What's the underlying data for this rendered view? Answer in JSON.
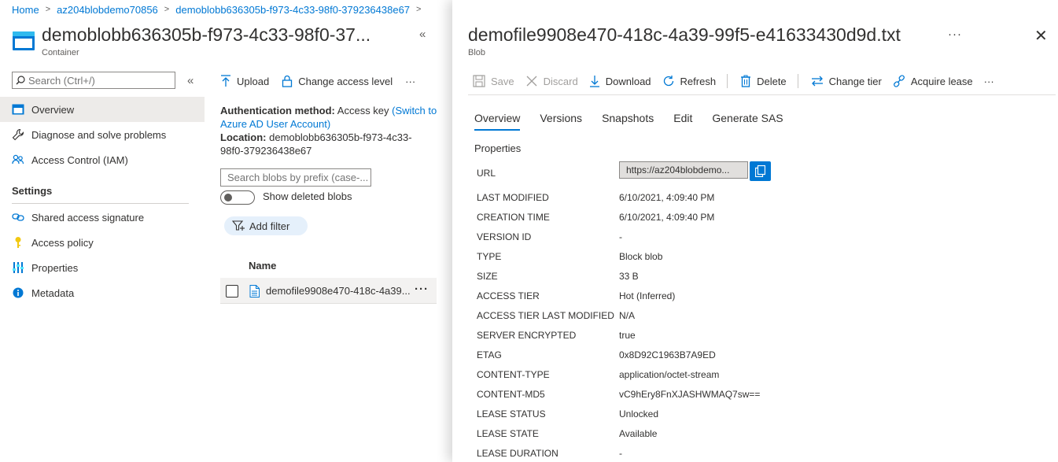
{
  "breadcrumb": {
    "items": [
      "Home",
      "az204blobdemo70856",
      "demoblobb636305b-f973-4c33-98f0-379236438e67"
    ],
    "separator": ">"
  },
  "container": {
    "title": "demoblobb636305b-f973-4c33-98f0-37...",
    "subtitle": "Container"
  },
  "search": {
    "placeholder": "Search (Ctrl+/)"
  },
  "nav": {
    "items": [
      {
        "label": "Overview",
        "icon": "container-icon",
        "selected": true
      },
      {
        "label": "Diagnose and solve problems",
        "icon": "wrench-icon"
      },
      {
        "label": "Access Control (IAM)",
        "icon": "people-icon"
      }
    ],
    "settings_heading": "Settings",
    "settings_items": [
      {
        "label": "Shared access signature",
        "icon": "link-icon"
      },
      {
        "label": "Access policy",
        "icon": "key-icon"
      },
      {
        "label": "Properties",
        "icon": "properties-icon"
      },
      {
        "label": "Metadata",
        "icon": "info-icon"
      }
    ]
  },
  "middle": {
    "toolbar": {
      "upload": "Upload",
      "change_access": "Change access level",
      "more": "···"
    },
    "auth": {
      "label": "Authentication method:",
      "value": "Access key",
      "link_line1": "(Switch to",
      "link_line2": "Azure AD User Account)"
    },
    "location": {
      "label": "Location:",
      "value_line1": "demoblobb636305b-f973-4c33-",
      "value_line2": "98f0-379236438e67"
    },
    "blob_search": {
      "placeholder": "Search blobs by prefix (case-..."
    },
    "show_deleted": {
      "label": "Show deleted blobs",
      "on": false
    },
    "add_filter": "Add filter",
    "column_name": "Name",
    "rows": [
      {
        "name": "demofile9908e470-418c-4a39...",
        "more": "···"
      }
    ]
  },
  "panel": {
    "title": "demofile9908e470-418c-4a39-99f5-e41633430d9d.txt",
    "subtitle": "Blob",
    "more": "···",
    "close": "✕",
    "toolbar": {
      "save": "Save",
      "discard": "Discard",
      "download": "Download",
      "refresh": "Refresh",
      "delete": "Delete",
      "change_tier": "Change tier",
      "acquire_lease": "Acquire lease",
      "more": "···"
    },
    "tabs": [
      "Overview",
      "Versions",
      "Snapshots",
      "Edit",
      "Generate SAS"
    ],
    "properties_heading": "Properties",
    "url": {
      "label": "URL",
      "value": "https://az204blobdemo..."
    },
    "properties": [
      {
        "key": "LAST MODIFIED",
        "value": "6/10/2021, 4:09:40 PM"
      },
      {
        "key": "CREATION TIME",
        "value": "6/10/2021, 4:09:40 PM"
      },
      {
        "key": "VERSION ID",
        "value": "-"
      },
      {
        "key": "TYPE",
        "value": "Block blob"
      },
      {
        "key": "SIZE",
        "value": "33 B"
      },
      {
        "key": "ACCESS TIER",
        "value": "Hot (Inferred)"
      },
      {
        "key": "ACCESS TIER LAST MODIFIED",
        "value": "N/A"
      },
      {
        "key": "SERVER ENCRYPTED",
        "value": "true"
      },
      {
        "key": "ETAG",
        "value": "0x8D92C1963B7A9ED"
      },
      {
        "key": "CONTENT-TYPE",
        "value": "application/octet-stream"
      },
      {
        "key": "CONTENT-MD5",
        "value": "vC9hEry8FnXJASHWMAQ7sw=="
      },
      {
        "key": "LEASE STATUS",
        "value": "Unlocked"
      },
      {
        "key": "LEASE STATE",
        "value": "Available"
      },
      {
        "key": "LEASE DURATION",
        "value": "-"
      }
    ]
  },
  "colors": {
    "accent": "#0078d4",
    "selected_nav": "#edebe9",
    "disabled_text": "#a19f9d"
  }
}
